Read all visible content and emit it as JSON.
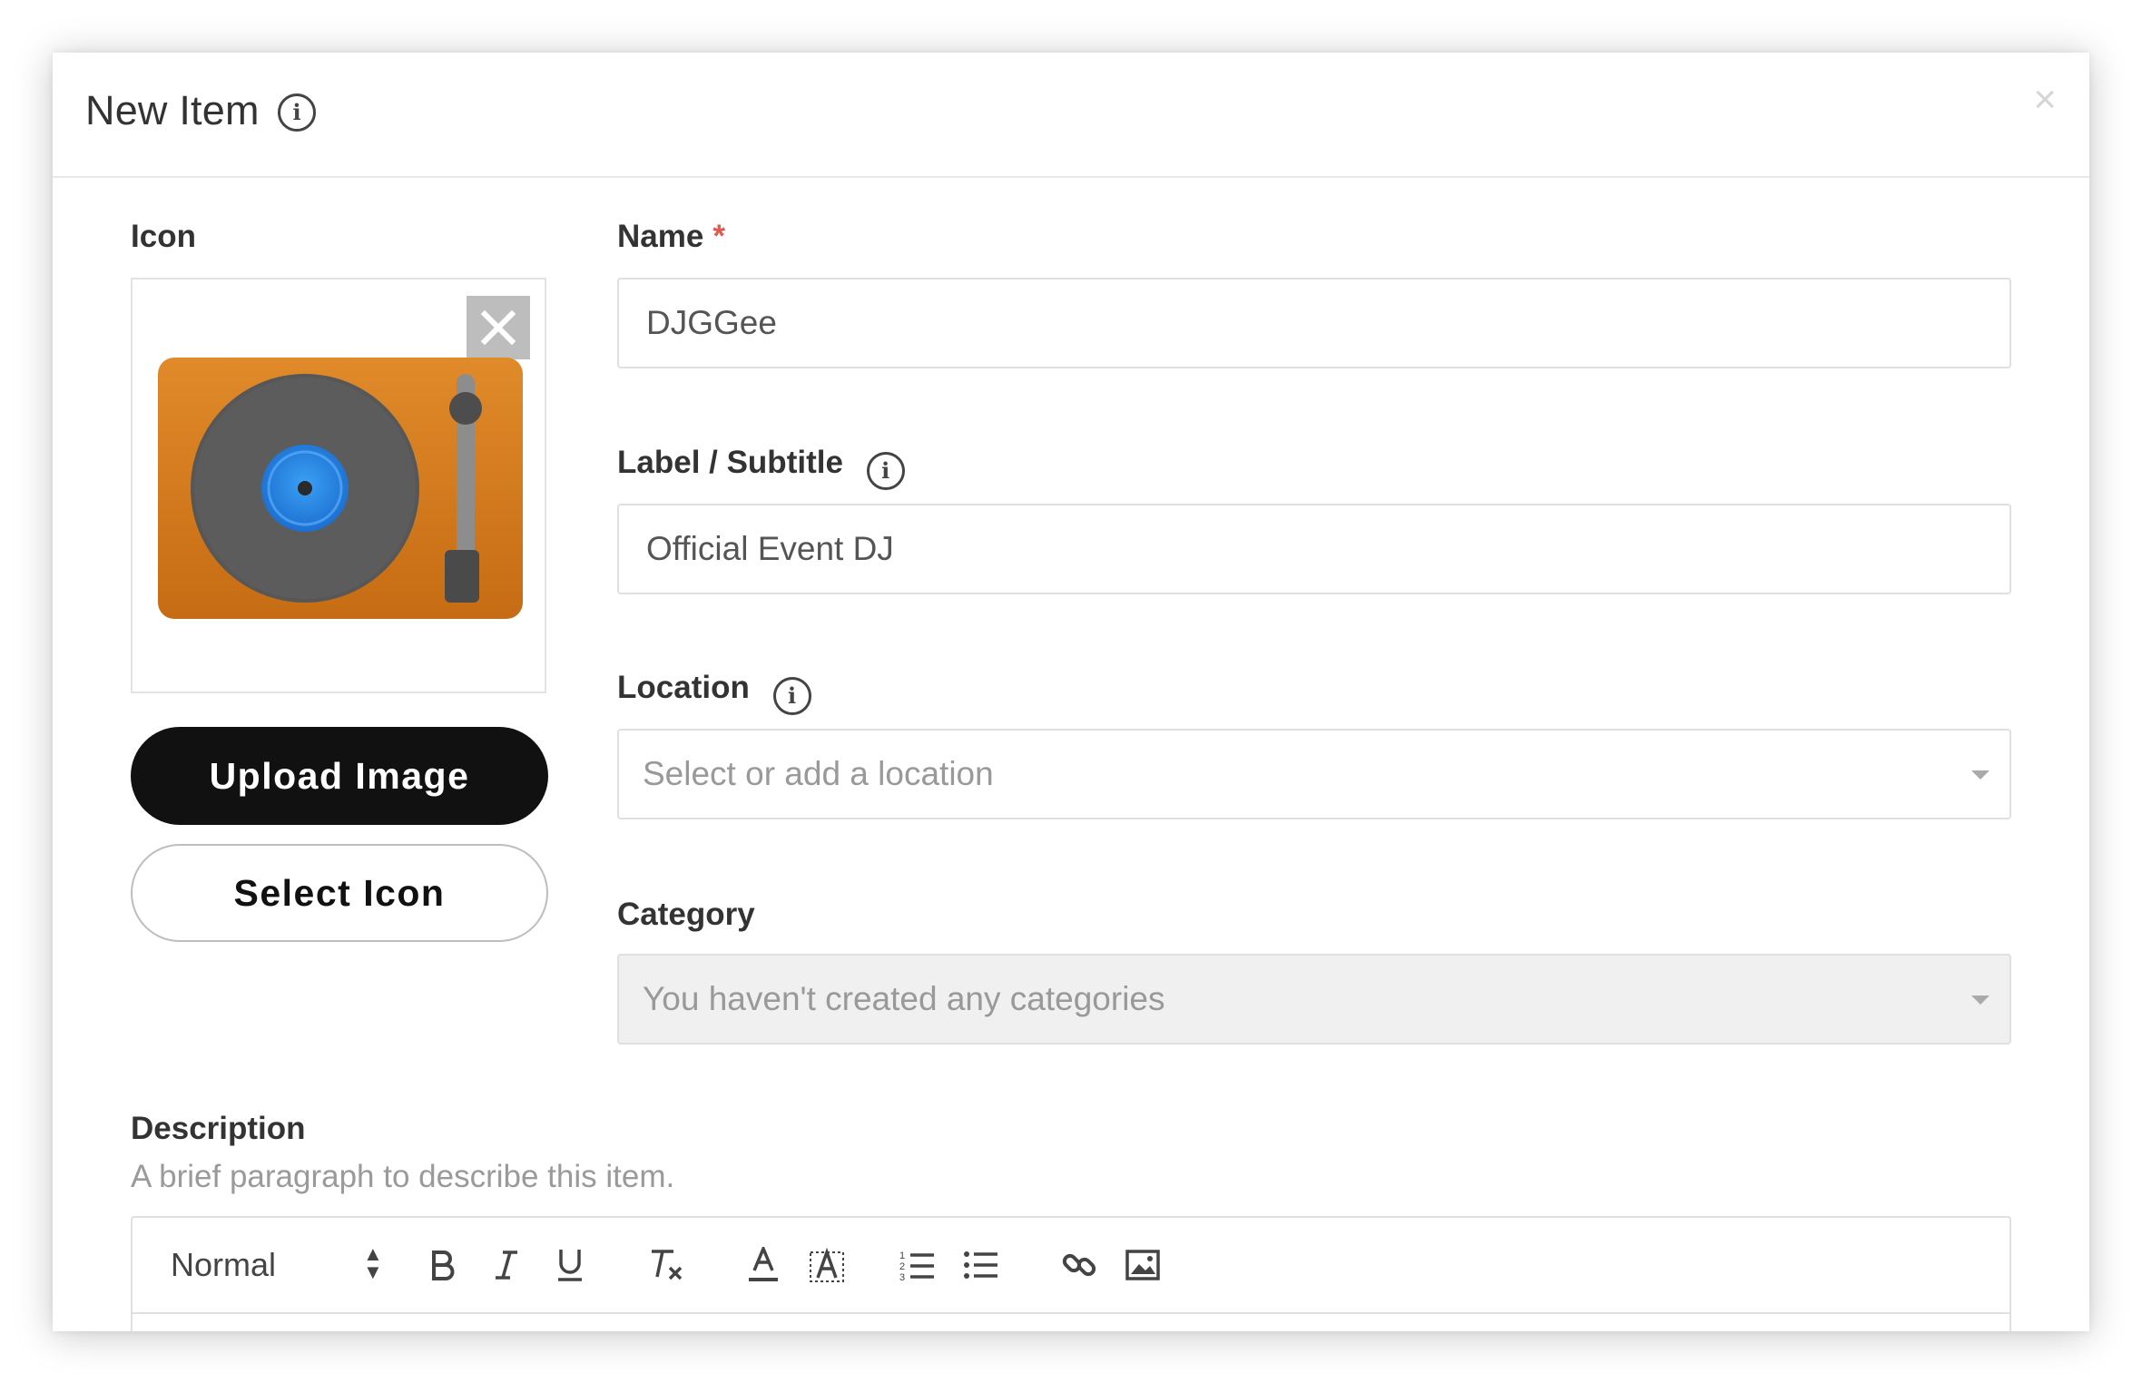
{
  "modal": {
    "title": "New Item",
    "close_symbol": "×"
  },
  "icon_section": {
    "label": "Icon",
    "image_name": "turntable-icon",
    "upload_label": "Upload Image",
    "select_label": "Select Icon"
  },
  "fields": {
    "name": {
      "label": "Name",
      "required_mark": "*",
      "value": "DJGGee"
    },
    "subtitle": {
      "label": "Label / Subtitle",
      "value": "Official Event DJ"
    },
    "location": {
      "label": "Location",
      "placeholder": "Select or add a location"
    },
    "category": {
      "label": "Category",
      "placeholder": "You haven't created any categories"
    }
  },
  "description": {
    "label": "Description",
    "help": "A brief paragraph to describe this item.",
    "toolbar": {
      "format_value": "Normal",
      "buttons": [
        "bold-icon",
        "italic-icon",
        "underline-icon",
        "clear-format-icon",
        "font-color-icon",
        "background-color-icon",
        "ordered-list-icon",
        "bullet-list-icon",
        "link-icon",
        "image-icon"
      ]
    }
  },
  "colors": {
    "accent_dark": "#111111",
    "required": "#e05a4e",
    "turntable_body": "#d27a1f",
    "record": "#5a5a5a",
    "record_label": "#2f8fe6"
  }
}
